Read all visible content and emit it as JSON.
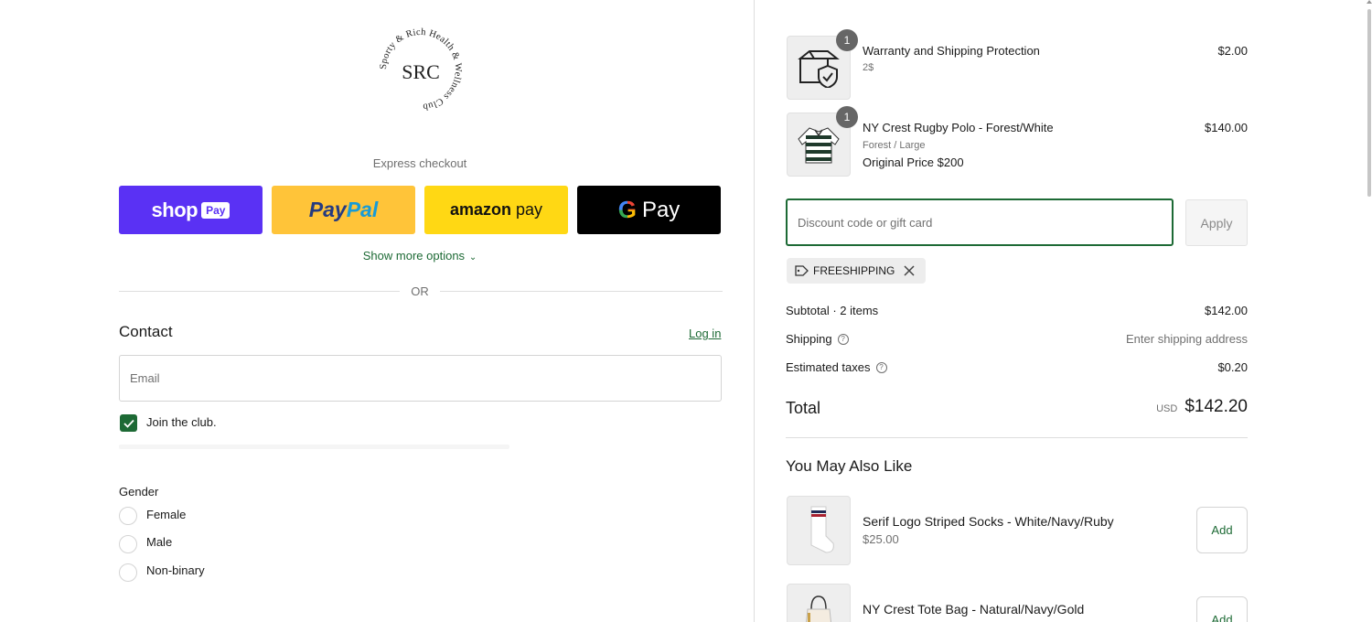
{
  "brand": {
    "logo_ring_text": "Sporty & Rich Health & Wellness Club",
    "logo_monogram": "SRC"
  },
  "express": {
    "label": "Express checkout",
    "shop_pay": {
      "word": "shop",
      "pay": "Pay",
      "color": "#5a31f4"
    },
    "paypal": {
      "part1": "Pay",
      "part2": "Pal",
      "color": "#ffc439"
    },
    "amazon_pay": {
      "word": "amazon",
      "pay": "pay",
      "color": "#ffd814"
    },
    "google_pay": {
      "g": "G",
      "pay": "Pay",
      "color": "#000000"
    },
    "show_more": "Show more options",
    "or": "OR"
  },
  "contact": {
    "title": "Contact",
    "login": "Log in",
    "email_placeholder": "Email",
    "join_label": "Join the club.",
    "join_checked": true
  },
  "gender": {
    "label": "Gender",
    "options": [
      "Female",
      "Male",
      "Non-binary"
    ]
  },
  "cart": {
    "items": [
      {
        "qty": "1",
        "name": "Warranty and Shipping Protection",
        "variant": "2$",
        "extra": "",
        "price": "$2.00",
        "icon": "package-shield-icon"
      },
      {
        "qty": "1",
        "name": "NY Crest Rugby Polo - Forest/White",
        "variant": "Forest / Large",
        "extra": "Original Price $200",
        "price": "$140.00",
        "icon": "striped-rugby-shirt-icon"
      }
    ],
    "discount_placeholder": "Discount code or gift card",
    "apply": "Apply",
    "applied_code": "FREESHIPPING",
    "summary": {
      "subtotal_label": "Subtotal · 2 items",
      "subtotal": "$142.00",
      "shipping_label": "Shipping",
      "shipping": "Enter shipping address",
      "taxes_label": "Estimated taxes",
      "taxes": "$0.20",
      "total_label": "Total",
      "currency": "USD",
      "total": "$142.20"
    }
  },
  "recommendations": {
    "title": "You May Also Like",
    "items": [
      {
        "name": "Serif Logo Striped Socks - White/Navy/Ruby",
        "price": "$25.00",
        "add": "Add",
        "icon": "striped-sock-icon"
      },
      {
        "name": "NY Crest Tote Bag - Natural/Navy/Gold",
        "price": "",
        "add": "Add",
        "icon": "tote-bag-icon"
      }
    ]
  },
  "colors": {
    "accent_green": "#1d6a35",
    "border": "#dedede",
    "muted_text": "#707070"
  }
}
